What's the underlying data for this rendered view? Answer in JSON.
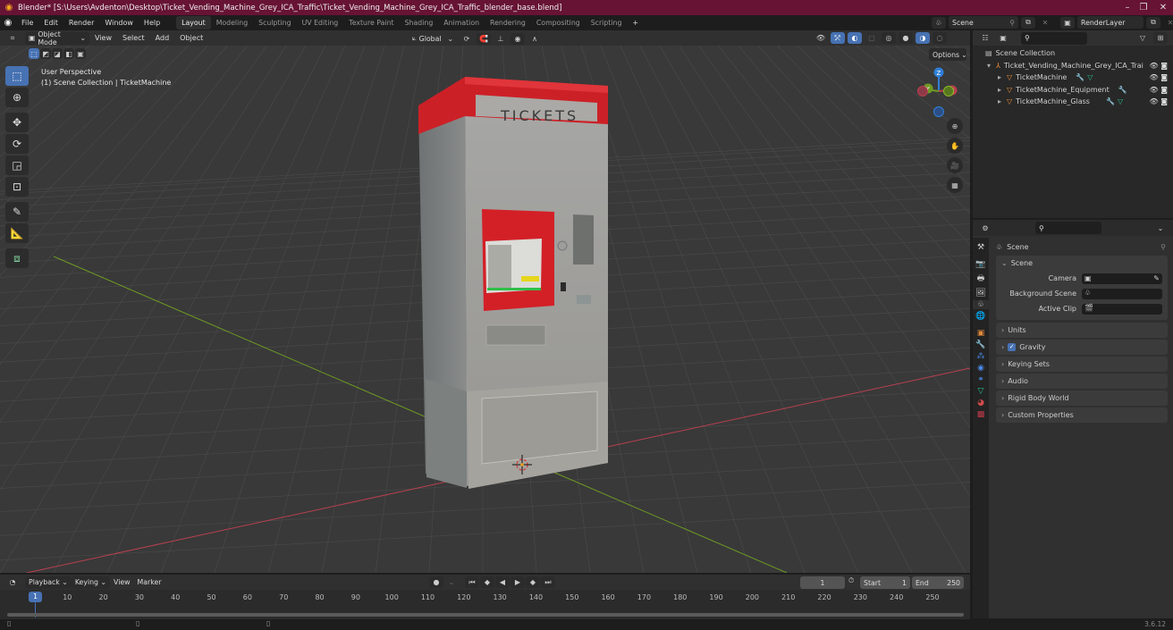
{
  "window": {
    "title": "Blender* [S:\\Users\\Avdenton\\Desktop\\Ticket_Vending_Machine_Grey_ICA_Traffic\\Ticket_Vending_Machine_Grey_ICA_Traffic_blender_base.blend]",
    "minimize": "–",
    "maximize": "❐",
    "close": "✕"
  },
  "menu": [
    "File",
    "Edit",
    "Render",
    "Window",
    "Help"
  ],
  "workspaces": [
    "Layout",
    "Modeling",
    "Sculpting",
    "UV Editing",
    "Texture Paint",
    "Shading",
    "Animation",
    "Rendering",
    "Compositing",
    "Scripting"
  ],
  "workspace_active": "Layout",
  "add_workspace": "+",
  "scene_selector": {
    "value": "Scene"
  },
  "view_layer_selector": {
    "value": "RenderLayer"
  },
  "viewport_header": {
    "mode": "Object Mode",
    "menus": [
      "View",
      "Select",
      "Add",
      "Object"
    ],
    "transform_orientation": "Global",
    "options_label": "Options"
  },
  "viewport": {
    "perspective_label": "User Perspective",
    "collection_label": "(1) Scene Collection | TicketMachine",
    "model_sign": "TICKETS",
    "gizmo": {
      "z": "Z",
      "y": "Y",
      "x": "X"
    },
    "colors": {
      "x_axis": "#b8404f",
      "y_axis": "#6e9a24",
      "z_axis": "#2f7fd6",
      "machine_red": "#d32027",
      "machine_grey": "#9c9c9a"
    }
  },
  "outliner": {
    "root": "Scene Collection",
    "collection": "Ticket_Vending_Machine_Grey_ICA_Trai",
    "objects": [
      {
        "name": "TicketMachine"
      },
      {
        "name": "TicketMachine_Equipment"
      },
      {
        "name": "TicketMachine_Glass"
      }
    ]
  },
  "properties": {
    "context_title": "Scene",
    "scene_panel": {
      "title": "Scene",
      "fields": [
        {
          "label": "Camera",
          "value": ""
        },
        {
          "label": "Background Scene",
          "value": ""
        },
        {
          "label": "Active Clip",
          "value": ""
        }
      ]
    },
    "collapsed_panels": [
      {
        "label": "Units",
        "checkbox": false
      },
      {
        "label": "Gravity",
        "checkbox": true
      },
      {
        "label": "Keying Sets",
        "checkbox": false
      },
      {
        "label": "Audio",
        "checkbox": false
      },
      {
        "label": "Rigid Body World",
        "checkbox": false
      },
      {
        "label": "Custom Properties",
        "checkbox": false
      }
    ]
  },
  "timeline": {
    "menus": [
      "Playback",
      "Keying",
      "View",
      "Marker"
    ],
    "current_frame": "1",
    "start_label": "Start",
    "start": "1",
    "end_label": "End",
    "end": "250",
    "ticks": [
      "10",
      "20",
      "30",
      "40",
      "50",
      "60",
      "70",
      "80",
      "90",
      "100",
      "110",
      "120",
      "130",
      "140",
      "150",
      "160",
      "170",
      "180",
      "190",
      "200",
      "210",
      "220",
      "230",
      "240",
      "250"
    ],
    "playhead": "1"
  },
  "status": {
    "version": "3.6.12"
  }
}
